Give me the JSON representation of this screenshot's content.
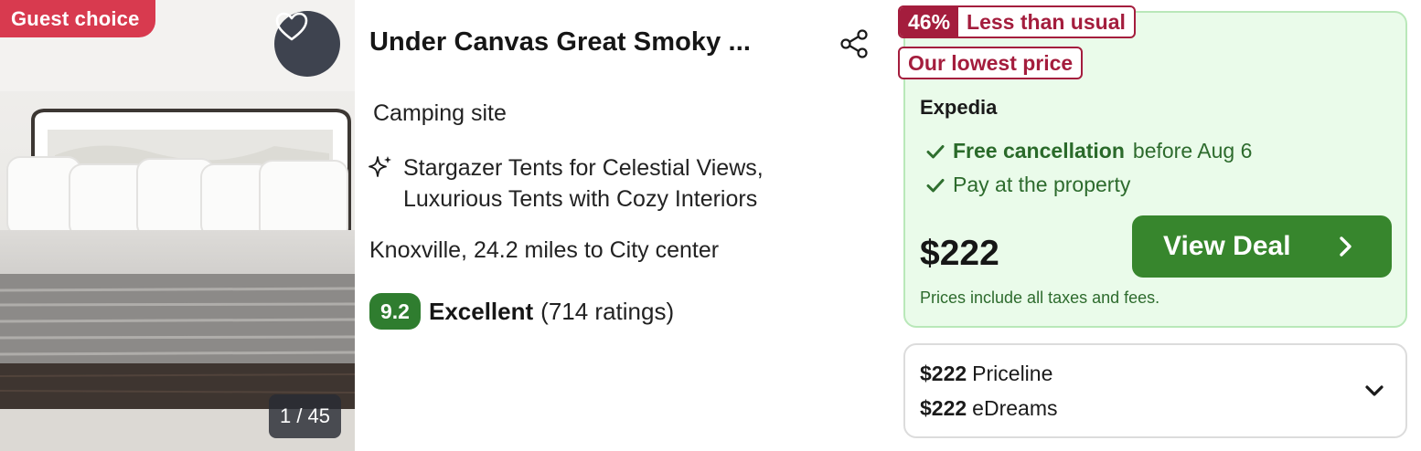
{
  "photo": {
    "badge": "Guest choice",
    "counter": "1 / 45"
  },
  "listing": {
    "title": "Under Canvas Great Smoky ...",
    "property_type": "Camping site",
    "highlights_line1": "Stargazer Tents for Celestial Views,",
    "highlights_line2": "Luxurious Tents with Cozy Interiors",
    "location": "Knoxville, 24.2 miles to City center",
    "score": "9.2",
    "rating_word": "Excellent",
    "rating_count": "(714 ratings)"
  },
  "deal": {
    "discount_pct": "46%",
    "discount_label": "Less than usual",
    "lowest_label": "Our lowest price",
    "provider": "Expedia",
    "perk1_bold": "Free cancellation",
    "perk1_rest": "before Aug 6",
    "perk2": "Pay at the property",
    "price": "$222",
    "cta": "View Deal",
    "fees_note": "Prices include all taxes and fees.",
    "accent_color": "#37862d",
    "tag_color": "#a41d3d"
  },
  "other_offers": [
    {
      "price": "$222",
      "provider": "Priceline"
    },
    {
      "price": "$222",
      "provider": "eDreams"
    }
  ],
  "icons": [
    "heart-icon",
    "share-icon",
    "sparkle-icon",
    "check-icon",
    "chevron-right-icon",
    "chevron-down-icon"
  ]
}
